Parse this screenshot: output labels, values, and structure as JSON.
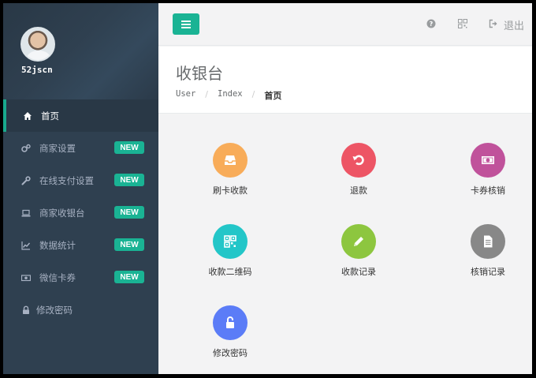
{
  "sidebar": {
    "username": "52jscn",
    "items": [
      {
        "label": "首页",
        "icon": "home-icon",
        "badge": ""
      },
      {
        "label": "商家设置",
        "icon": "cogs-icon",
        "badge": "NEW"
      },
      {
        "label": "在线支付设置",
        "icon": "wrench-icon",
        "badge": "NEW"
      },
      {
        "label": "商家收银台",
        "icon": "laptop-icon",
        "badge": "NEW"
      },
      {
        "label": "数据统计",
        "icon": "line-chart-icon",
        "badge": "NEW"
      },
      {
        "label": "微信卡券",
        "icon": "money-icon",
        "badge": "NEW"
      },
      {
        "label": "修改密码",
        "icon": "lock-icon",
        "badge": ""
      }
    ]
  },
  "topbar": {
    "logout_label": "退出",
    "icons": [
      "menu-icon",
      "help-icon",
      "qrcode-icon",
      "sign-out-icon"
    ]
  },
  "header": {
    "title": "收银台",
    "breadcrumb": [
      "User",
      "Index",
      "首页"
    ]
  },
  "actions": [
    {
      "label": "刷卡收款",
      "icon": "inbox-icon",
      "color": "#f8ac59"
    },
    {
      "label": "退款",
      "icon": "undo-icon",
      "color": "#ed5565"
    },
    {
      "label": "卡券核销",
      "icon": "money-icon",
      "color": "#c0529b"
    },
    {
      "label": "收款二维码",
      "icon": "qrcode-icon",
      "color": "#23c6c8"
    },
    {
      "label": "收款记录",
      "icon": "pencil-icon",
      "color": "#8dc63f"
    },
    {
      "label": "核销记录",
      "icon": "file-icon",
      "color": "#888888"
    },
    {
      "label": "修改密码",
      "icon": "unlock-icon",
      "color": "#5b7cf7"
    }
  ],
  "colors": {
    "sidebar_bg": "#2f4050",
    "accent": "#1ab394",
    "active_border": "#19aa8d"
  }
}
